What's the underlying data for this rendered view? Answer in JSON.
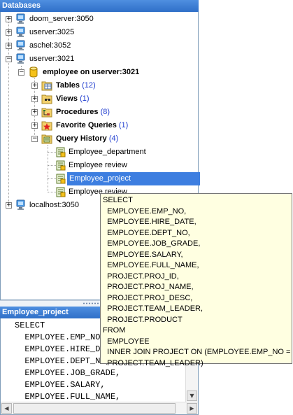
{
  "databases_panel": {
    "title": "Databases",
    "servers": [
      {
        "label": "doom_server:3050"
      },
      {
        "label": "userver:3025"
      },
      {
        "label": "aschel:3052"
      },
      {
        "label": "userver:3021"
      },
      {
        "label": "localhost:3050"
      }
    ],
    "database": {
      "label": "employee on userver:3021"
    },
    "nodes": [
      {
        "label": "Tables",
        "count": "(12)"
      },
      {
        "label": "Views",
        "count": "(1)"
      },
      {
        "label": "Procedures",
        "count": "(8)"
      },
      {
        "label": "Favorite Queries",
        "count": "(1)"
      },
      {
        "label": "Query History",
        "count": "(4)"
      }
    ],
    "history_items": [
      {
        "label": "Employee_department"
      },
      {
        "label": "Employee review"
      },
      {
        "label": "Employee_project"
      },
      {
        "label": "Employee review"
      }
    ]
  },
  "query_panel": {
    "title": "Employee_project",
    "sql_lines": [
      "SELECT",
      "  EMPLOYEE.EMP_NO,",
      "  EMPLOYEE.HIRE_DATE,",
      "  EMPLOYEE.DEPT_NO,",
      "  EMPLOYEE.JOB_GRADE,",
      "  EMPLOYEE.SALARY,",
      "  EMPLOYEE.FULL_NAME,"
    ]
  },
  "tooltip": {
    "lines": [
      "SELECT",
      "  EMPLOYEE.EMP_NO,",
      "  EMPLOYEE.HIRE_DATE,",
      "  EMPLOYEE.DEPT_NO,",
      "  EMPLOYEE.JOB_GRADE,",
      "  EMPLOYEE.SALARY,",
      "  EMPLOYEE.FULL_NAME,",
      "  PROJECT.PROJ_ID,",
      "  PROJECT.PROJ_NAME,",
      "  PROJECT.PROJ_DESC,",
      "  PROJECT.TEAM_LEADER,",
      "  PROJECT.PRODUCT",
      "FROM",
      "  EMPLOYEE",
      "  INNER JOIN PROJECT ON (EMPLOYEE.EMP_NO =",
      "  PROJECT.TEAM_LEADER)"
    ]
  },
  "colors": {
    "header_blue": "#3d7ee0",
    "selection": "#3d7ee0",
    "count_text": "#1e3ccf",
    "tooltip_bg": "#ffffe1"
  },
  "icons": {
    "server": "server-icon",
    "database": "database-icon",
    "tables": "tables-icon",
    "views": "views-icon",
    "procedures": "procedures-icon",
    "favorite_queries": "star-folder-icon",
    "query_history": "history-folder-icon",
    "query": "query-icon"
  }
}
